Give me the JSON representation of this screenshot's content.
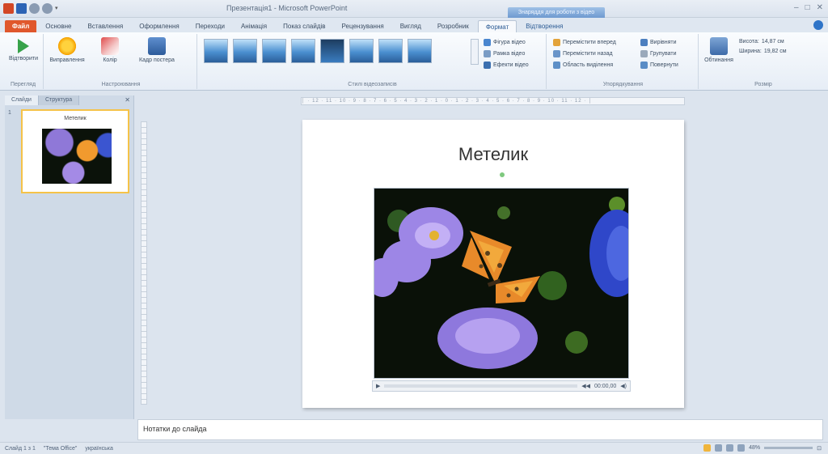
{
  "window": {
    "title": "Презентація1 - Microsoft PowerPoint",
    "context_tab_group": "Знаряддя для роботи з відео"
  },
  "tabs": [
    "Файл",
    "Основне",
    "Вставлення",
    "Оформлення",
    "Переходи",
    "Анімація",
    "Показ слайдів",
    "Рецензування",
    "Вигляд",
    "Розробник",
    "Формат",
    "Відтворення"
  ],
  "ribbon": {
    "groups": [
      {
        "label": "Перегляд",
        "buttons": [
          "Відтворити"
        ]
      },
      {
        "label": "Настроювання",
        "buttons": [
          "Виправлення",
          "Колір",
          "Кадр постера"
        ]
      },
      {
        "label": "Стилі відеозаписів",
        "buttons": [
          "Фігура відео",
          "Рамка відео",
          "Ефекти відео"
        ]
      },
      {
        "label": "Упорядкування",
        "buttons": [
          "Перемістити вперед",
          "Перемістити назад",
          "Область виділення",
          "Вирівняти",
          "Групувати",
          "Повернути"
        ]
      },
      {
        "label": "Розмір",
        "buttons": [
          "Обтинання",
          "Висота:",
          "Ширина:"
        ]
      }
    ],
    "size": {
      "height": "14,87 см",
      "width": "19,82 см"
    }
  },
  "left_panel": {
    "tabs": [
      "Слайди",
      "Структура"
    ],
    "slide_number": "1",
    "thumbnail_title": "Метелик"
  },
  "slide": {
    "title": "Метелик",
    "video_controls": {
      "time": "00:00,00"
    }
  },
  "notes": {
    "text": "Нотатки до слайда"
  },
  "status_bar": {
    "slide_info": "Слайд 1 з 1",
    "theme": "\"Тема Office\"",
    "language": "українська",
    "zoom": "48%"
  },
  "colors": {
    "file_tab": "#e0572c",
    "accent": "#2f74c8",
    "thumb_highlight": "#f5c349"
  }
}
